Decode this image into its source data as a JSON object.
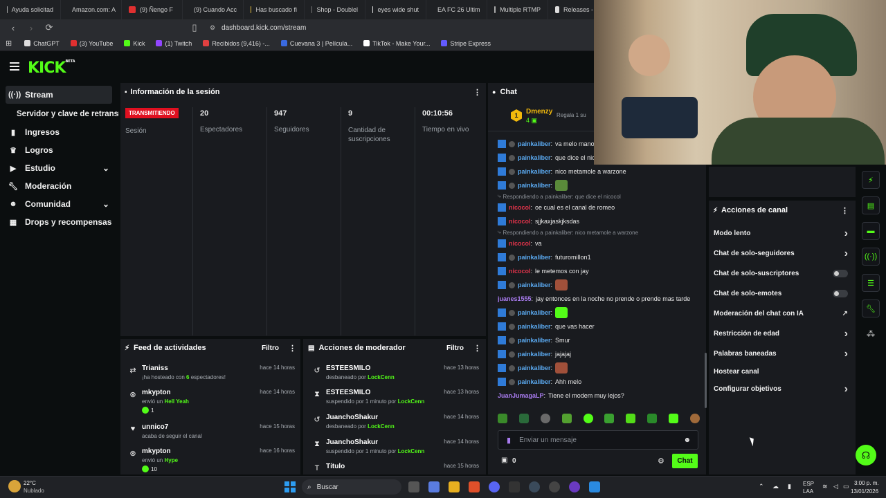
{
  "browser": {
    "tabs": [
      "Ayuda solicitad",
      "Amazon.com: A",
      "(9) Ñengo F",
      "(9) Cuando Acc",
      "Has buscado fi",
      "Shop - Doublel",
      "eyes wide shut",
      "EA FC 26 Ultim",
      "Multiple RTMP",
      "Releases - so"
    ],
    "url": "dashboard.kick.com/stream",
    "bookmarks": [
      "ChatGPT",
      "(3) YouTube",
      "Kick",
      "(1) Twitch",
      "Recibidos (9,416) -...",
      "Cuevana 3 | Película...",
      "TikTok - Make Your...",
      "Stripe Express"
    ]
  },
  "sidebar": {
    "items": [
      {
        "label": "Stream",
        "icon": "broadcast-icon"
      },
      {
        "label": "Servidor y clave de retransmisión",
        "icon": ""
      },
      {
        "label": "Ingresos",
        "icon": "chart-icon"
      },
      {
        "label": "Logros",
        "icon": "trophy-icon"
      },
      {
        "label": "Estudio",
        "icon": "camera-icon"
      },
      {
        "label": "Moderación",
        "icon": "wrench-icon"
      },
      {
        "label": "Comunidad",
        "icon": "people-icon"
      },
      {
        "label": "Drops y recompensas",
        "icon": "gift-icon"
      }
    ]
  },
  "session": {
    "title": "Información de la sesión",
    "status": "TRANSMITIENDO",
    "status_label": "Sesión",
    "stats": [
      {
        "value": "20",
        "label": "Espectadores"
      },
      {
        "value": "947",
        "label": "Seguidores"
      },
      {
        "value": "9",
        "label": "Cantidad de suscripciones"
      },
      {
        "value": "00:10:56",
        "label": "Tiempo en vivo"
      }
    ]
  },
  "activity": {
    "title": "Feed de actividades",
    "filter": "Filtro",
    "items": [
      {
        "name": "Trianiss",
        "desc_pre": "¡ha hosteado con ",
        "hl": "6",
        "desc_post": " espectadores!",
        "time": "hace 14 horas",
        "extra": ""
      },
      {
        "name": "mkypton",
        "desc_pre": "envió un ",
        "hl": "Hell Yeah",
        "desc_post": "",
        "time": "hace 14 horas",
        "extra": "1"
      },
      {
        "name": "unnico7",
        "desc_pre": "acaba de seguir el canal",
        "hl": "",
        "desc_post": "",
        "time": "hace 15 horas",
        "extra": ""
      },
      {
        "name": "mkypton",
        "desc_pre": "envió un ",
        "hl": "Hype",
        "desc_post": "",
        "time": "hace 16 horas",
        "extra": "10"
      }
    ]
  },
  "modactions": {
    "title": "Acciones de moderador",
    "filter": "Filtro",
    "items": [
      {
        "name": "ESTEESMILO",
        "desc": "desbaneado por ",
        "mod": "LockCenn",
        "time": "hace 13 horas"
      },
      {
        "name": "ESTEESMILO",
        "desc": "suspendido por 1 minuto por ",
        "mod": "LockCenn",
        "time": "hace 13 horas"
      },
      {
        "name": "JuanchoShakur",
        "desc": "desbaneado por ",
        "mod": "LockCenn",
        "time": "hace 14 horas"
      },
      {
        "name": "JuanchoShakur",
        "desc": "suspendido por 1 minuto por ",
        "mod": "LockCenn",
        "time": "hace 14 horas"
      },
      {
        "name": "Título",
        "desc": "",
        "mod": "",
        "time": "hace 15 horas"
      }
    ]
  },
  "chat": {
    "title": "Chat",
    "pinned_user": "Dmenzy",
    "pinned_count": "4",
    "pinned_rank": "1",
    "pinned_action": "Regala 1 su",
    "reply_prefix": "Respondiendo a",
    "messages": [
      {
        "user": "painkaliber",
        "text": "va melo mano",
        "color": "blue"
      },
      {
        "user": "painkaliber",
        "text": "que dice el nic",
        "color": "blue"
      },
      {
        "user": "painkaliber",
        "text": "nico metamole a warzone",
        "color": "blue"
      },
      {
        "user": "painkaliber",
        "text": "",
        "emote": "#5a8a3a",
        "color": "blue"
      },
      {
        "reply": "painkaliber: que dice el nicocol",
        "user": "nicocol",
        "text": "oe cual es el canal de romeo",
        "color": "red"
      },
      {
        "user": "nicocol",
        "text": "sjjkaxjaskjksdas",
        "color": "red"
      },
      {
        "reply": "painkaliber: nico metamole a warzone",
        "user": "nicocol",
        "text": "va",
        "color": "red"
      },
      {
        "user": "painkaliber",
        "text": "futuromillon1",
        "color": "blue"
      },
      {
        "user": "nicocol",
        "text": "le metemos con jay",
        "color": "red"
      },
      {
        "user": "painkaliber",
        "text": "",
        "emote": "#a0503a",
        "color": "blue"
      },
      {
        "user": "juanes1555",
        "text": "jay entonces en la noche no prende o prende mas tarde",
        "color": "purple",
        "nobadge": true
      },
      {
        "user": "painkaliber",
        "text": "",
        "emote": "#53fc18",
        "color": "blue"
      },
      {
        "user": "painkaliber",
        "text": "que vas hacer",
        "color": "blue"
      },
      {
        "user": "painkaliber",
        "text": "Smur",
        "color": "blue"
      },
      {
        "user": "painkaliber",
        "text": "jajajaj",
        "color": "blue"
      },
      {
        "user": "painkaliber",
        "text": "",
        "emote": "#a0503a",
        "color": "blue"
      },
      {
        "user": "painkaliber",
        "text": "Ahh melo",
        "color": "blue"
      },
      {
        "user": "JuanJumagaLP",
        "text": "Tiene el modem muy lejos?",
        "color": "purple",
        "nobadge": true
      }
    ],
    "placeholder": "Enviar un mensaje",
    "points": "0",
    "send": "Chat"
  },
  "channel_actions": {
    "title": "Acciones de canal",
    "items": [
      {
        "label": "Modo lento",
        "ctrl": "chevron"
      },
      {
        "label": "Chat de solo-seguidores",
        "ctrl": "chevron"
      },
      {
        "label": "Chat de solo-suscriptores",
        "ctrl": "toggle"
      },
      {
        "label": "Chat de solo-emotes",
        "ctrl": "toggle"
      },
      {
        "label": "Moderación del chat con IA",
        "ctrl": "ext"
      },
      {
        "label": "Restricción de edad",
        "ctrl": "chevron"
      },
      {
        "label": "Palabras baneadas",
        "ctrl": "chevron"
      },
      {
        "label": "Hostear canal",
        "ctrl": ""
      },
      {
        "label": "Configurar objetivos",
        "ctrl": "chevron"
      }
    ]
  },
  "taskbar": {
    "weather_temp": "22°C",
    "weather_desc": "Nublado",
    "search": "Buscar",
    "lang1": "ESP",
    "lang2": "LAA",
    "time": "3:00 p. m.",
    "date": "13/01/2026"
  }
}
